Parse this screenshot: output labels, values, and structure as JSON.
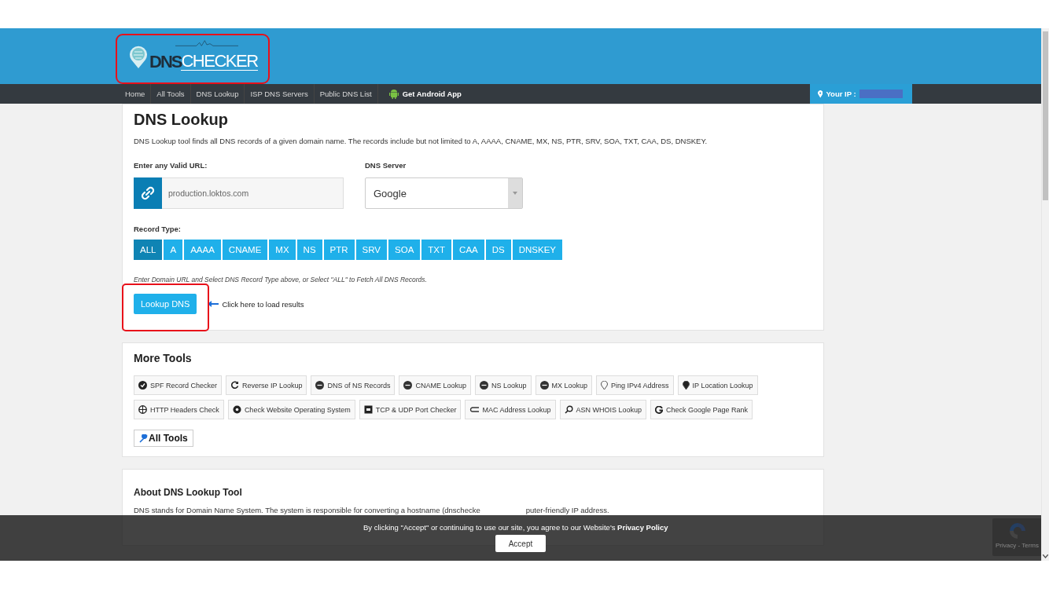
{
  "logo": {
    "bold": "DNS",
    "light": "CHECKER"
  },
  "nav": {
    "items": [
      {
        "label": "Home",
        "kind": "link"
      },
      {
        "label": "All Tools",
        "kind": "link"
      },
      {
        "label": "DNS Lookup",
        "kind": "link"
      },
      {
        "label": "ISP DNS Servers",
        "kind": "link"
      },
      {
        "label": "Public DNS List",
        "kind": "link"
      },
      {
        "label": "Get Android App",
        "kind": "app"
      }
    ],
    "your_ip": "Your IP :"
  },
  "lookup": {
    "title": "DNS Lookup",
    "description": "DNS Lookup tool finds all DNS records of a given domain name. The records include but not limited to A, AAAA, CNAME, MX, NS, PTR, SRV, SOA, TXT, CAA, DS, DNSKEY.",
    "url_label": "Enter any Valid URL:",
    "url_value": "production.loktos.com",
    "server_label": "DNS Server",
    "server_value": "Google",
    "record_label": "Record Type:",
    "record_types": [
      {
        "label": "ALL",
        "selected": true
      },
      {
        "label": "A",
        "selected": false
      },
      {
        "label": "AAAA",
        "selected": false
      },
      {
        "label": "CNAME",
        "selected": false
      },
      {
        "label": "MX",
        "selected": false
      },
      {
        "label": "NS",
        "selected": false
      },
      {
        "label": "PTR",
        "selected": false
      },
      {
        "label": "SRV",
        "selected": false
      },
      {
        "label": "SOA",
        "selected": false
      },
      {
        "label": "TXT",
        "selected": false
      },
      {
        "label": "CAA",
        "selected": false
      },
      {
        "label": "DS",
        "selected": false
      },
      {
        "label": "DNSKEY",
        "selected": false
      }
    ],
    "hint": "Enter Domain URL and Select DNS Record Type above, or Select \"ALL\" to Fetch All DNS Records.",
    "button": "Lookup DNS",
    "callout": "Click here to load results"
  },
  "more_tools": {
    "title": "More Tools",
    "tools": [
      "SPF Record Checker",
      "Reverse IP Lookup",
      "DNS of NS Records",
      "CNAME Lookup",
      "NS Lookup",
      "MX Lookup",
      "Ping IPv4 Address",
      "IP Location Lookup",
      "HTTP Headers Check",
      "Check Website Operating System",
      "TCP & UDP Port Checker",
      "MAC Address Lookup",
      "ASN WHOIS Lookup",
      "Check Google Page Rank"
    ],
    "all_tools": "All Tools"
  },
  "about": {
    "title": "About DNS Lookup Tool",
    "text_before": "DNS stands for Domain Name System. The system is responsible for converting a hostname (dnschecke",
    "text_after": "puter-friendly IP address."
  },
  "cookie_banner": {
    "text": "By clicking \"Accept\" or continuing to use our site, you agree to our Website's **Privacy Policy**",
    "button": "Accept"
  },
  "recaptcha": {
    "text": "Privacy - Terms"
  }
}
